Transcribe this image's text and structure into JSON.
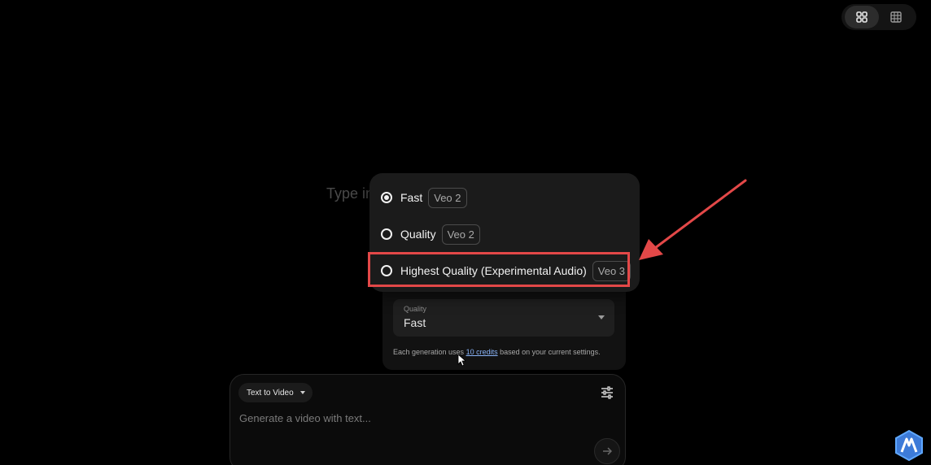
{
  "toolbar": {
    "view_grid_large_icon": "grid-2x2-icon",
    "view_grid_small_icon": "grid-3x3-icon"
  },
  "background_prompt": {
    "text": "Type in"
  },
  "quality_menu": {
    "options": [
      {
        "label": "Fast",
        "badge": "Veo 2",
        "selected": true
      },
      {
        "label": "Quality",
        "badge": "Veo 2",
        "selected": false
      },
      {
        "label": "Highest Quality (Experimental Audio)",
        "badge": "Veo 3",
        "selected": false
      }
    ],
    "highlight_color": "#e34848"
  },
  "settings": {
    "quality_label": "Quality",
    "quality_value": "Fast",
    "credits_prefix": "Each generation uses ",
    "credits_link": "10 credits",
    "credits_suffix": " based on your current settings."
  },
  "composer": {
    "mode_label": "Text to Video",
    "placeholder": "Generate a video with text..."
  },
  "colors": {
    "background": "#000000",
    "accent_link": "#8ab4f8",
    "annotation": "#e34848"
  }
}
